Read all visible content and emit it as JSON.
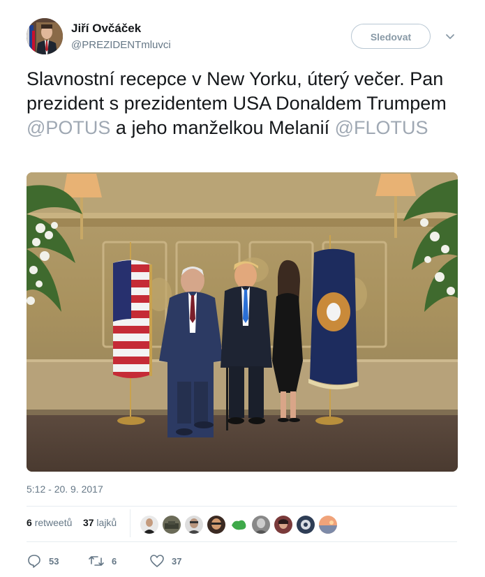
{
  "author": {
    "name": "Jiří Ovčáček",
    "handle": "@PREZIDENTmluvci"
  },
  "follow_label": "Sledovat",
  "tweet": {
    "text_part1": "Slavnostní recepce v New Yorku, úterý večer. Pan prezident s prezidentem USA Donaldem Trumpem ",
    "mention1": "@POTUS",
    "text_part2": " a jeho manželkou Melanií ",
    "mention2": "@FLOTUS"
  },
  "timestamp": "5:12 - 20. 9. 2017",
  "stats": {
    "retweets_count": "6",
    "retweets_label": "retweetů",
    "likes_count": "37",
    "likes_label": "lajků"
  },
  "likers_count_shown": 9,
  "actions": {
    "reply_count": "53",
    "retweet_count": "6",
    "like_count": "37"
  },
  "icons": [
    "caret-down-icon",
    "reply-icon",
    "retweet-icon",
    "heart-icon"
  ],
  "colors": {
    "text": "#14171a",
    "secondary": "#657786",
    "mention": "#9fa8b3",
    "border": "#e6ecf0"
  }
}
